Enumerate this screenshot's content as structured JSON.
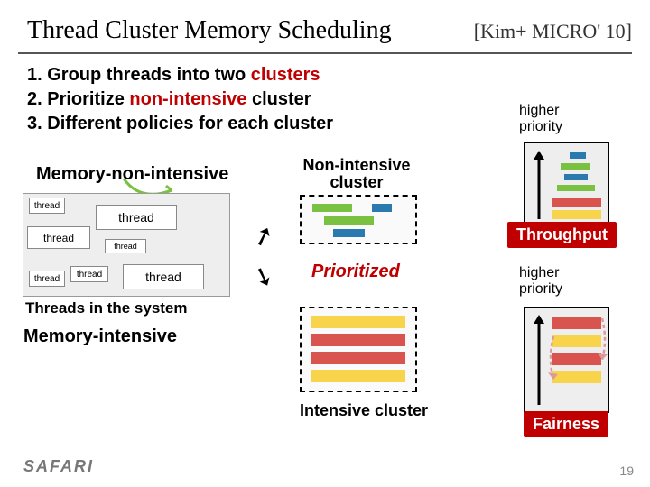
{
  "title": "Thread Cluster Memory Scheduling",
  "citation": "[Kim+ MICRO' 10]",
  "bullets": [
    {
      "num": "1.",
      "text_a": "Group threads into two ",
      "red": "clusters",
      "text_b": ""
    },
    {
      "num": "2.",
      "text_a": "Prioritize ",
      "red": "non-intensive",
      "text_b": " cluster"
    },
    {
      "num": "3.",
      "text_a": "Different policies for each cluster",
      "red": "",
      "text_b": ""
    }
  ],
  "labels": {
    "mem_non_intensive": "Memory-non-intensive",
    "non_intensive_cluster": "Non-intensive cluster",
    "higher_priority": "higher\npriority",
    "threads_in_system": "Threads in the system",
    "mem_intensive": "Memory-intensive",
    "prioritized": "Prioritized",
    "intensive_cluster": "Intensive cluster",
    "throughput": "Throughput",
    "fairness": "Fairness",
    "thread": "thread"
  },
  "footer": {
    "brand": "SAFARI",
    "page": "19"
  }
}
